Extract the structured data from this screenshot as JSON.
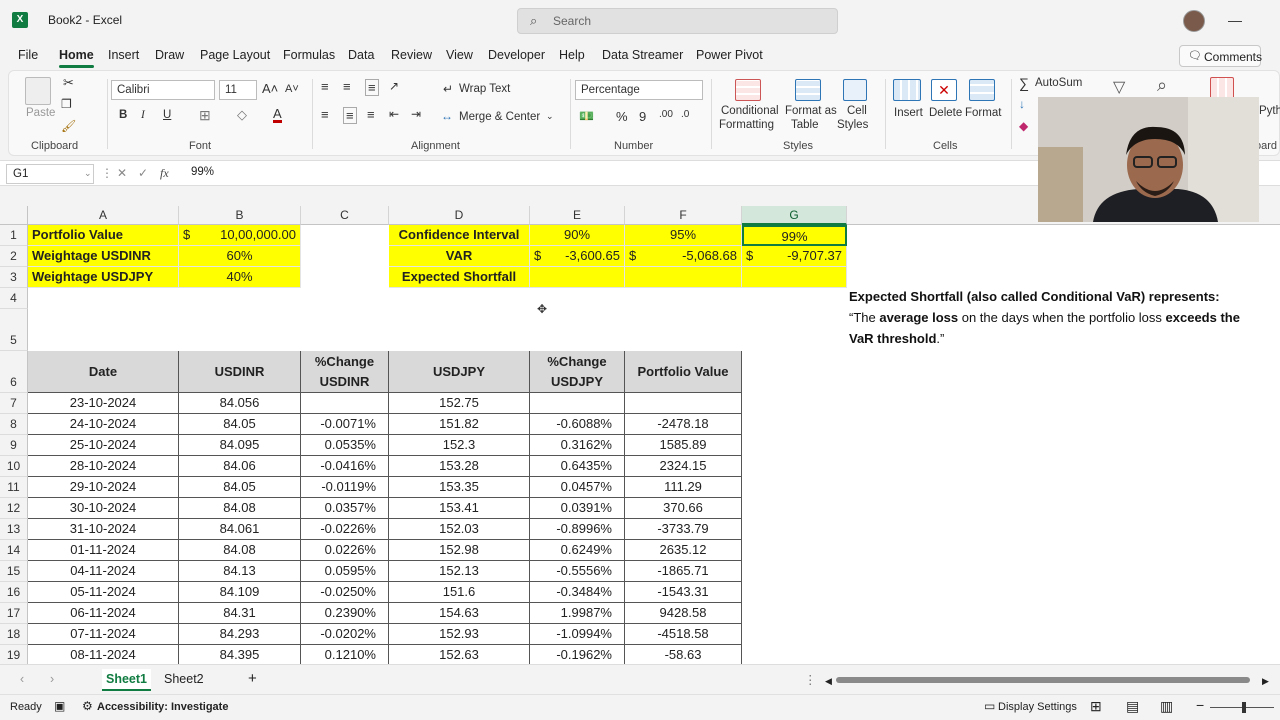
{
  "title_bar": {
    "app_title": "Book2  -  Excel",
    "search_placeholder": "Search"
  },
  "menu": {
    "tabs": [
      "File",
      "Home",
      "Insert",
      "Draw",
      "Page Layout",
      "Formulas",
      "Data",
      "Review",
      "View",
      "Developer",
      "Help",
      "Data Streamer",
      "Power Pivot"
    ],
    "active": "Home",
    "comments_label": "Comments"
  },
  "ribbon": {
    "clipboard": {
      "paste": "Paste",
      "label": "Clipboard"
    },
    "font": {
      "name": "Calibri",
      "size": "11",
      "label": "Font",
      "bold": "B",
      "italic": "I",
      "underline": "U"
    },
    "alignment": {
      "wrap_text": "Wrap Text",
      "merge_center": "Merge & Center",
      "label": "Alignment"
    },
    "number": {
      "format": "Percentage",
      "label": "Number"
    },
    "styles": {
      "conditional_1": "Conditional",
      "conditional_2": "Formatting",
      "format_as_1": "Format as",
      "format_as_2": "Table",
      "cell_1": "Cell",
      "cell_2": "Styles",
      "label": "Styles"
    },
    "cells": {
      "insert": "Insert",
      "delete": "Delete",
      "format": "Format",
      "label": "Cells"
    },
    "editing": {
      "autosum": "AutoSum"
    },
    "extra": {
      "python": "Pyth",
      "board": "oard"
    }
  },
  "formula_bar": {
    "cell_ref": "G1",
    "value": "99%"
  },
  "columns": [
    "A",
    "B",
    "C",
    "D",
    "E",
    "F",
    "G"
  ],
  "selected_column": "G",
  "rows": [
    "1",
    "2",
    "3",
    "4",
    "5",
    "6",
    "7",
    "8",
    "9",
    "10",
    "11",
    "12",
    "13",
    "14",
    "15",
    "16",
    "17",
    "18",
    "19"
  ],
  "summary": {
    "portfolio_value_label": "Portfolio Value",
    "portfolio_value_currency": "$",
    "portfolio_value": "10,00,000.00",
    "weight_inr_label": "Weightage USDINR",
    "weight_inr": "60%",
    "weight_jpy_label": "Weightage USDJPY",
    "weight_jpy": "40%",
    "ci_label": "Confidence Interval",
    "ci_values": [
      "90%",
      "95%",
      "99%"
    ],
    "var_label": "VAR",
    "var_currency": "$",
    "var_values": [
      "-3,600.65",
      "-5,068.68",
      "-9,707.37"
    ],
    "es_label": "Expected Shortfall"
  },
  "note": {
    "line1": "Expected Shortfall (also called Conditional VaR) represents:",
    "line2_pre": "“The ",
    "line2_bold1": "average loss",
    "line2_mid": " on the days when the portfolio loss ",
    "line2_bold2": "exceeds the",
    "line3_bold": "VaR threshold",
    "line3_post": ".”"
  },
  "table": {
    "headers": [
      "Date",
      "USDINR",
      "%Change USDINR",
      "USDJPY",
      "%Change USDJPY",
      "Portfolio Value"
    ],
    "rows": [
      [
        "23-10-2024",
        "84.056",
        "",
        "152.75",
        "",
        ""
      ],
      [
        "24-10-2024",
        "84.05",
        "-0.0071%",
        "151.82",
        "-0.6088%",
        "-2478.18"
      ],
      [
        "25-10-2024",
        "84.095",
        "0.0535%",
        "152.3",
        "0.3162%",
        "1585.89"
      ],
      [
        "28-10-2024",
        "84.06",
        "-0.0416%",
        "153.28",
        "0.6435%",
        "2324.15"
      ],
      [
        "29-10-2024",
        "84.05",
        "-0.0119%",
        "153.35",
        "0.0457%",
        "111.29"
      ],
      [
        "30-10-2024",
        "84.08",
        "0.0357%",
        "153.41",
        "0.0391%",
        "370.66"
      ],
      [
        "31-10-2024",
        "84.061",
        "-0.0226%",
        "152.03",
        "-0.8996%",
        "-3733.79"
      ],
      [
        "01-11-2024",
        "84.08",
        "0.0226%",
        "152.98",
        "0.6249%",
        "2635.12"
      ],
      [
        "04-11-2024",
        "84.13",
        "0.0595%",
        "152.13",
        "-0.5556%",
        "-1865.71"
      ],
      [
        "05-11-2024",
        "84.109",
        "-0.0250%",
        "151.6",
        "-0.3484%",
        "-1543.31"
      ],
      [
        "06-11-2024",
        "84.31",
        "0.2390%",
        "154.63",
        "1.9987%",
        "9428.58"
      ],
      [
        "07-11-2024",
        "84.293",
        "-0.0202%",
        "152.93",
        "-1.0994%",
        "-4518.58"
      ],
      [
        "08-11-2024",
        "84.395",
        "0.1210%",
        "152.63",
        "-0.1962%",
        "-58.63"
      ]
    ]
  },
  "sheets": {
    "tabs": [
      "Sheet1",
      "Sheet2"
    ],
    "active": "Sheet1"
  },
  "status": {
    "ready": "Ready",
    "accessibility": "Accessibility: Investigate",
    "display_settings": "Display Settings"
  }
}
